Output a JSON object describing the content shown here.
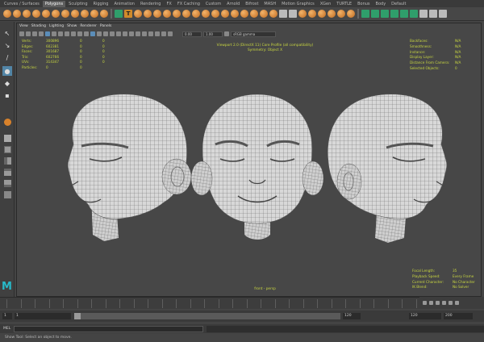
{
  "shelf_tabs": [
    "Curves / Surfaces",
    "Polygons",
    "Sculpting",
    "Rigging",
    "Animation",
    "Rendering",
    "FX",
    "FX Caching",
    "Custom",
    "Arnold",
    "Bifrost",
    "MASH",
    "Motion Graphics",
    "XGen",
    "TURTLE",
    "Bonus",
    "Body",
    "Default"
  ],
  "shelf_active": "Polygons",
  "viewport_menu": [
    "View",
    "Shading",
    "Lighting",
    "Show",
    "Renderer",
    "Panels"
  ],
  "vp_fields": {
    "near": "0.00",
    "far": "1.00",
    "color_space": "sRGB gamma"
  },
  "stats": {
    "rows": [
      {
        "label": "Verts:",
        "v1": "300896",
        "v2": "0",
        "v3": "0"
      },
      {
        "label": "Edges:",
        "v1": "602381",
        "v2": "0",
        "v3": "0"
      },
      {
        "label": "Faces:",
        "v1": "301687",
        "v2": "0",
        "v3": "0"
      },
      {
        "label": "Tris:",
        "v1": "602766",
        "v2": "0",
        "v3": "0"
      },
      {
        "label": "UVs:",
        "v1": "314347",
        "v2": "0",
        "v3": "0"
      },
      {
        "label": "Particles:",
        "v1": "0",
        "v2": "0",
        "v3": ""
      }
    ]
  },
  "hud_top": [
    "Viewport 2.0 (DirectX 11) Core Profile (all compatibility)",
    "Symmetry: Object X"
  ],
  "hud_right": [
    {
      "label": "Backfaces:",
      "value": "N/A"
    },
    {
      "label": "Smoothness:",
      "value": "N/A"
    },
    {
      "label": "Instance:",
      "value": "N/A"
    },
    {
      "label": "Display Layer:",
      "value": "N/A"
    },
    {
      "label": "Distance From Camera:",
      "value": "N/A"
    },
    {
      "label": "Selected Objects:",
      "value": "0"
    }
  ],
  "hud_bottom_right": [
    {
      "label": "Focal Length:",
      "value": "35"
    },
    {
      "label": "Playback Speed:",
      "value": "Every Frame"
    },
    {
      "label": "Current Character:",
      "value": "No Character"
    },
    {
      "label": "IK Blend:",
      "value": "No Solver"
    }
  ],
  "camera_name": "front - persp",
  "logo": "M",
  "range": {
    "start": "1",
    "playback_start": "1",
    "playback_end": "120",
    "end": "120",
    "end2": "200"
  },
  "cmd_label": "MEL",
  "help_text": "Show Tool: Select an object to move."
}
